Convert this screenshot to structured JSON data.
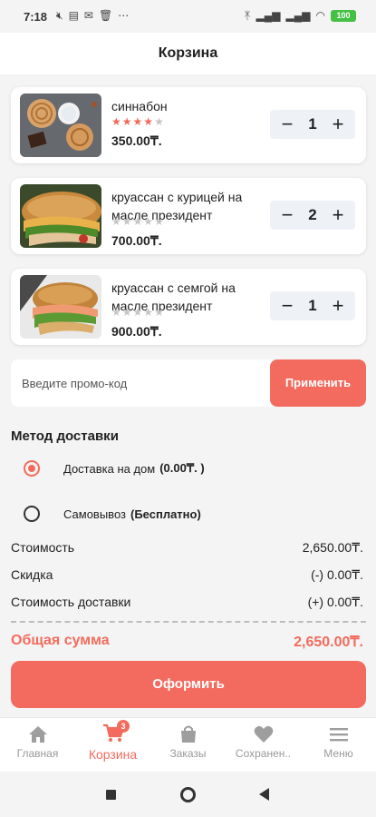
{
  "status": {
    "time": "7:18",
    "icons": [
      "mute-icon",
      "message-icon",
      "mail-icon",
      "trash-icon",
      "more-icon"
    ],
    "right_icons": [
      "bluetooth-icon",
      "signal-icon",
      "signal-icon",
      "wifi-icon"
    ],
    "battery": "100"
  },
  "header": {
    "title": "Корзина"
  },
  "cart": {
    "items": [
      {
        "name": "синнабон",
        "rating": 4,
        "max_rating": 5,
        "price": "350.00₸.",
        "qty": "1"
      },
      {
        "name": "круассан с курицей на масле президент",
        "rating": 0,
        "max_rating": 5,
        "price": "700.00₸.",
        "qty": "2"
      },
      {
        "name": "круассан с семгой на масле президент",
        "rating": 0,
        "max_rating": 5,
        "price": "900.00₸.",
        "qty": "1"
      }
    ],
    "minus": "−",
    "plus": "+"
  },
  "promo": {
    "placeholder": "Введите промо-код",
    "apply_label": "Применить"
  },
  "delivery": {
    "title": "Метод доставки",
    "options": [
      {
        "label": "Доставка на дом",
        "extra": "(0.00₸. )",
        "selected": true
      },
      {
        "label": "Самовывоз",
        "extra": "(Бесплатно)",
        "selected": false
      }
    ]
  },
  "summary": {
    "cost_label": "Стоимость",
    "cost_value": "2,650.00₸.",
    "discount_label": "Скидка",
    "discount_value": "(-) 0.00₸.",
    "delivery_label": "Стоимость доставки",
    "delivery_value": "(+) 0.00₸.",
    "total_label": "Общая сумма",
    "total_value": "2,650.00₸."
  },
  "checkout_label": "Оформить",
  "nav": {
    "items": [
      {
        "label": "Главная",
        "icon": "home-icon"
      },
      {
        "label": "Корзина",
        "icon": "cart-icon",
        "badge": "3",
        "active": true
      },
      {
        "label": "Заказы",
        "icon": "bag-icon"
      },
      {
        "label": "Сохранен..",
        "icon": "heart-icon"
      },
      {
        "label": "Меню",
        "icon": "menu-icon"
      }
    ]
  },
  "colors": {
    "accent": "#f36b5e",
    "background": "#f4f4f4",
    "card": "#ffffff",
    "muted": "#999999"
  }
}
